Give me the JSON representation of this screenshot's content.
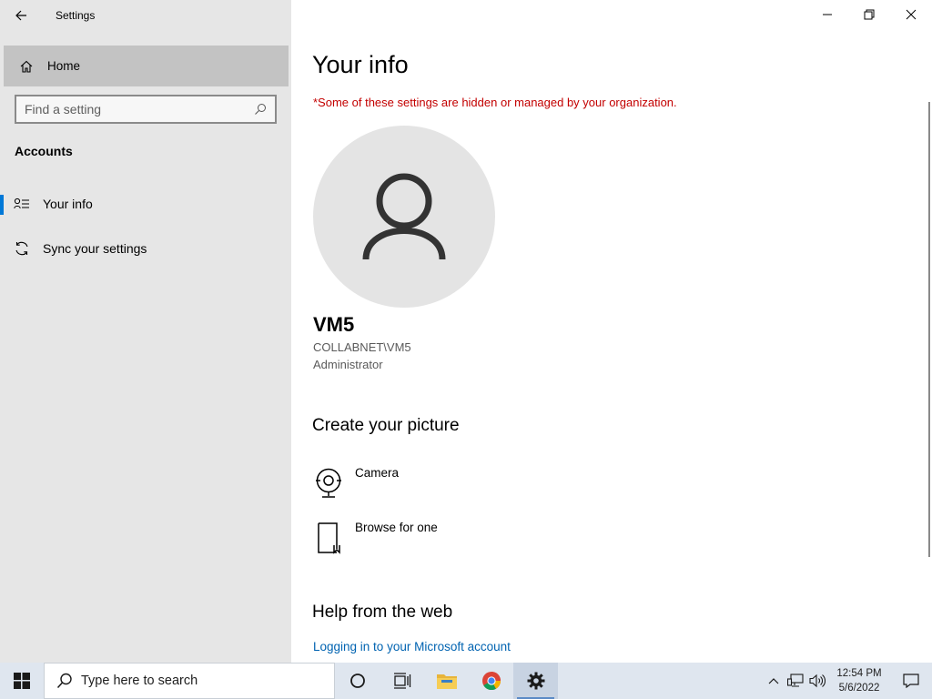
{
  "window": {
    "title": "Settings"
  },
  "sidebar": {
    "home_label": "Home",
    "search_placeholder": "Find a setting",
    "section_title": "Accounts",
    "items": [
      {
        "label": "Your info",
        "icon": "your-info-icon",
        "selected": true
      },
      {
        "label": "Sync your settings",
        "icon": "sync-icon",
        "selected": false
      }
    ]
  },
  "main": {
    "title": "Your info",
    "org_note": "*Some of these settings are hidden or managed by your organization.",
    "user": {
      "name": "VM5",
      "domain": "COLLABNET\\VM5",
      "role": "Administrator"
    },
    "create_picture": {
      "heading": "Create your picture",
      "options": [
        {
          "label": "Camera",
          "icon": "camera-icon"
        },
        {
          "label": "Browse for one",
          "icon": "browse-icon"
        }
      ]
    },
    "help": {
      "heading": "Help from the web",
      "link": "Logging in to your Microsoft account"
    }
  },
  "taskbar": {
    "search_text": "Type here to search",
    "clock_time": "12:54 PM",
    "clock_date": "5/6/2022"
  },
  "colors": {
    "accent": "#0078d7",
    "warning": "#c30000",
    "link": "#0063b1",
    "sidebar_bg": "#e6e6e6"
  }
}
